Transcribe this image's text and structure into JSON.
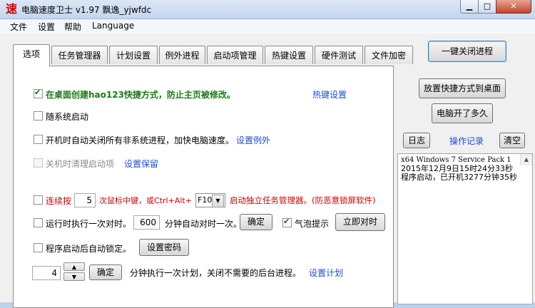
{
  "window": {
    "icon_glyph": "速",
    "title": "电脑速度卫士 v1.97 飘逸_yjwfdc",
    "min_glyph": "▁",
    "max_glyph": "□",
    "close_glyph": "✕"
  },
  "menu": [
    "文件",
    "设置",
    "帮助",
    "Language"
  ],
  "tabs": [
    "选项",
    "任务管理器",
    "计划设置",
    "例外进程",
    "启动项管理",
    "热键设置",
    "硬件测试",
    "文件加密"
  ],
  "right": {
    "close_all_label": "一键关闭进程",
    "shortcut_desktop_label": "放置快捷方式到桌面",
    "uptime_label": "电脑开了多久",
    "log_label": "日志",
    "op_record_label": "操作记录",
    "clear_label": "清空",
    "log_lines": [
      "x64 Windows 7 Service Pack 1",
      " 2015年12月9日15时24分33秒",
      " 程序启动，已开机3277分钟35秒"
    ]
  },
  "options": {
    "opt1_label": "在桌面创建hao123快捷方式，防止主页被修改。",
    "opt1_checked": true,
    "hotkey_link": "热键设置",
    "opt2_label": "随系统启动",
    "opt2_checked": false,
    "opt3_label": "开机时自动关闭所有非系统进程，加快电脑速度。",
    "set_exception_link": "设置例外",
    "opt4_label": "关机时清理启动项",
    "set_keep_link": "设置保留",
    "opt5_prefix": "连续按",
    "opt5_count": "5",
    "opt5_middle": "次鼠标中键，或Ctrl+Alt+",
    "opt5_key": "F10",
    "opt5_suffix": "启动独立任务管理器。(防恶意锁屏软件)",
    "opt6_label": "运行时执行一次对时。",
    "opt6_minutes": "600",
    "opt6_suffix": "分钟自动对时一次。",
    "opt6_confirm": "确定",
    "bubble_label": "气泡提示",
    "bubble_checked": true,
    "sync_now_label": "立即对时",
    "opt7_label": "程序启动后自动锁定。",
    "set_password_label": "设置密码",
    "plan_value": "4",
    "plan_confirm": "确定",
    "plan_text": "分钟执行一次计划，关闭不需要的后台进程。",
    "set_plan_link": "设置计划"
  }
}
